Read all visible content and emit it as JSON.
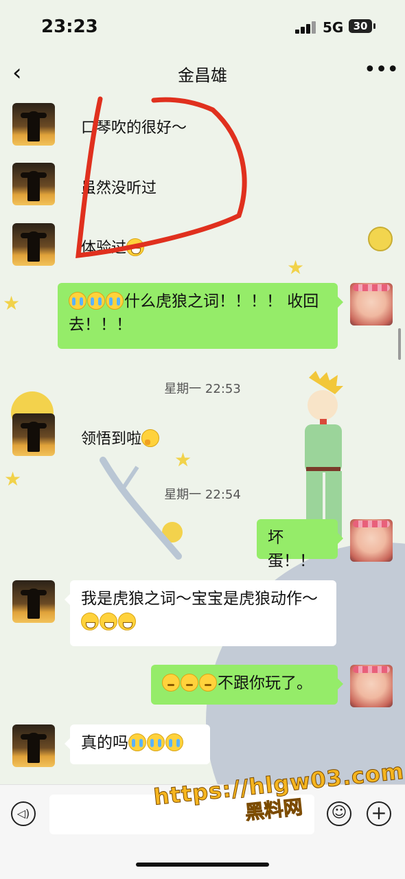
{
  "status_bar": {
    "time": "23:23",
    "network": "5G",
    "battery": "30"
  },
  "nav": {
    "title": "金昌雄"
  },
  "messages": [
    {
      "text": "口琴吹的很好～"
    },
    {
      "text": "虽然没听过"
    },
    {
      "text": "体验过"
    },
    {
      "text": "什么虎狼之词！！！！ 收回去！！！"
    },
    {
      "text": "领悟到啦"
    },
    {
      "text": "坏蛋！！"
    },
    {
      "text": "我是虎狼之词～宝宝是虎狼动作～"
    },
    {
      "text": "不跟你玩了。"
    },
    {
      "text": "真的吗"
    }
  ],
  "timestamps": [
    "星期一 22:53",
    "星期一 22:54"
  ],
  "watermark": {
    "url": "https://hlgw03.com",
    "name": "黑料网"
  },
  "colors": {
    "my_bubble": "#95ec69",
    "their_bubble": "#ffffff",
    "annotation": "#e0301e"
  }
}
